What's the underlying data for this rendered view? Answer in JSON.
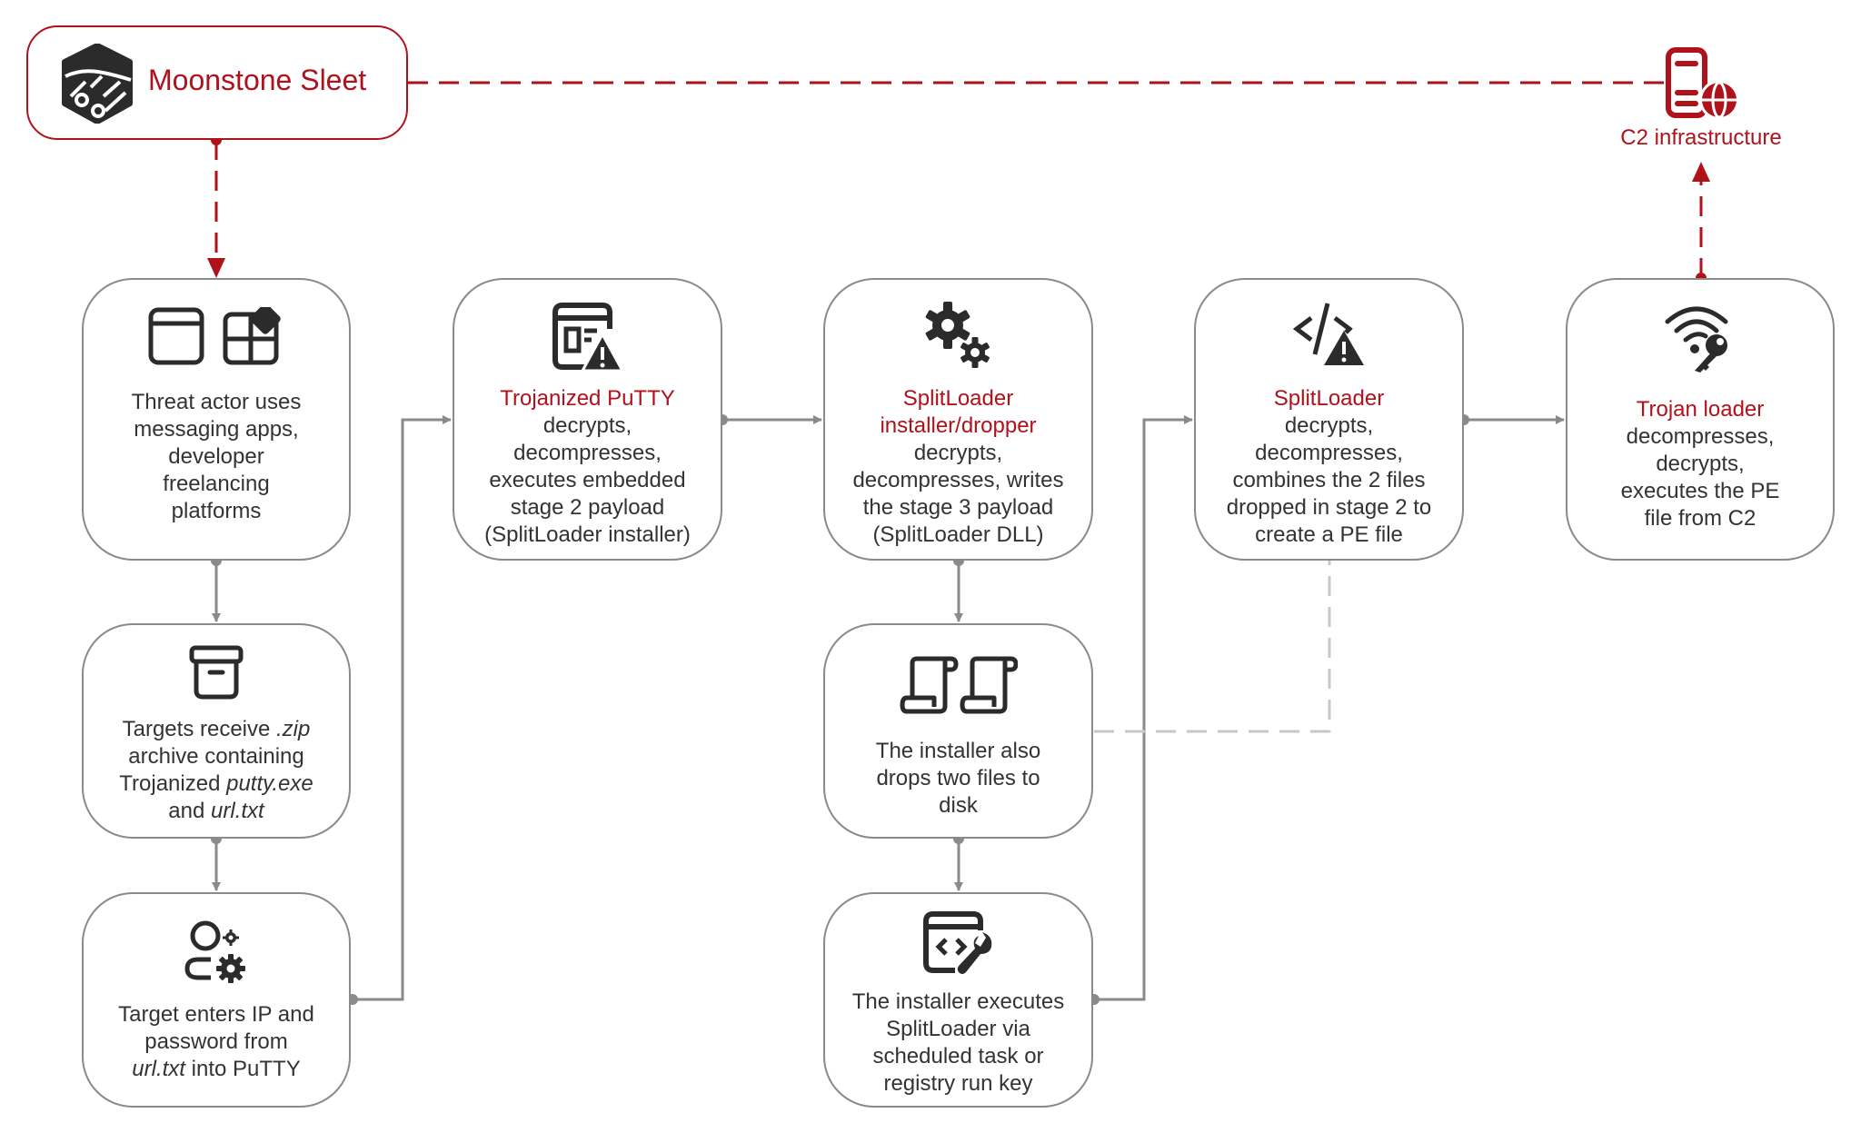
{
  "colors": {
    "accent": "#b0121b",
    "connector": "#8a8a8a",
    "dashed_gray": "#c8c8c8",
    "text": "#333333"
  },
  "actor": {
    "name": "Moonstone Sleet",
    "icon": "moonstone-sleet-logo-icon"
  },
  "c2": {
    "label": "C2 infrastructure",
    "icon": "server-globe-icon"
  },
  "boxes": {
    "messaging": {
      "icon": "window-apps-icon",
      "lines": [
        "Threat actor uses",
        "messaging apps,",
        "developer",
        "freelancing",
        "platforms"
      ]
    },
    "zip": {
      "icon": "archive-box-icon",
      "line1_a": "Targets receive ",
      "line1_b": ".zip",
      "line2": "archive containing",
      "line3_a": "Trojanized ",
      "line3_b": "putty.exe",
      "line4_a": "and ",
      "line4_b": "url.txt"
    },
    "enter": {
      "icon": "user-settings-icon",
      "line1": "Target enters IP and",
      "line2": "password from",
      "line3_a": "url.txt",
      "line3_b": " into PuTTY"
    },
    "putty": {
      "icon": "app-warning-icon",
      "title": "Trojanized PuTTY",
      "lines": [
        "decrypts,",
        "decompresses,",
        "executes embedded",
        "stage 2 payload",
        "(SplitLoader installer)"
      ]
    },
    "installer": {
      "icon": "gears-icon",
      "title_lines": [
        "SplitLoader",
        "installer/dropper"
      ],
      "lines": [
        "decrypts,",
        "decompresses, writes",
        "the stage 3 payload",
        "(SplitLoader DLL)"
      ]
    },
    "drops": {
      "icon": "scrolls-icon",
      "lines": [
        "The installer also",
        "drops two files to",
        "disk"
      ]
    },
    "executes": {
      "icon": "code-wrench-icon",
      "lines": [
        "The installer executes",
        "SplitLoader via",
        "scheduled task or",
        "registry run key"
      ]
    },
    "splitloader": {
      "icon": "code-warning-icon",
      "title": "SplitLoader",
      "lines": [
        "decrypts,",
        "decompresses,",
        "combines the 2 files",
        "dropped in stage 2 to",
        "create a PE file"
      ]
    },
    "trojan": {
      "icon": "wifi-key-icon",
      "title": "Trojan loader",
      "lines": [
        "decompresses,",
        "decrypts,",
        "executes the PE",
        "file from C2"
      ]
    }
  }
}
